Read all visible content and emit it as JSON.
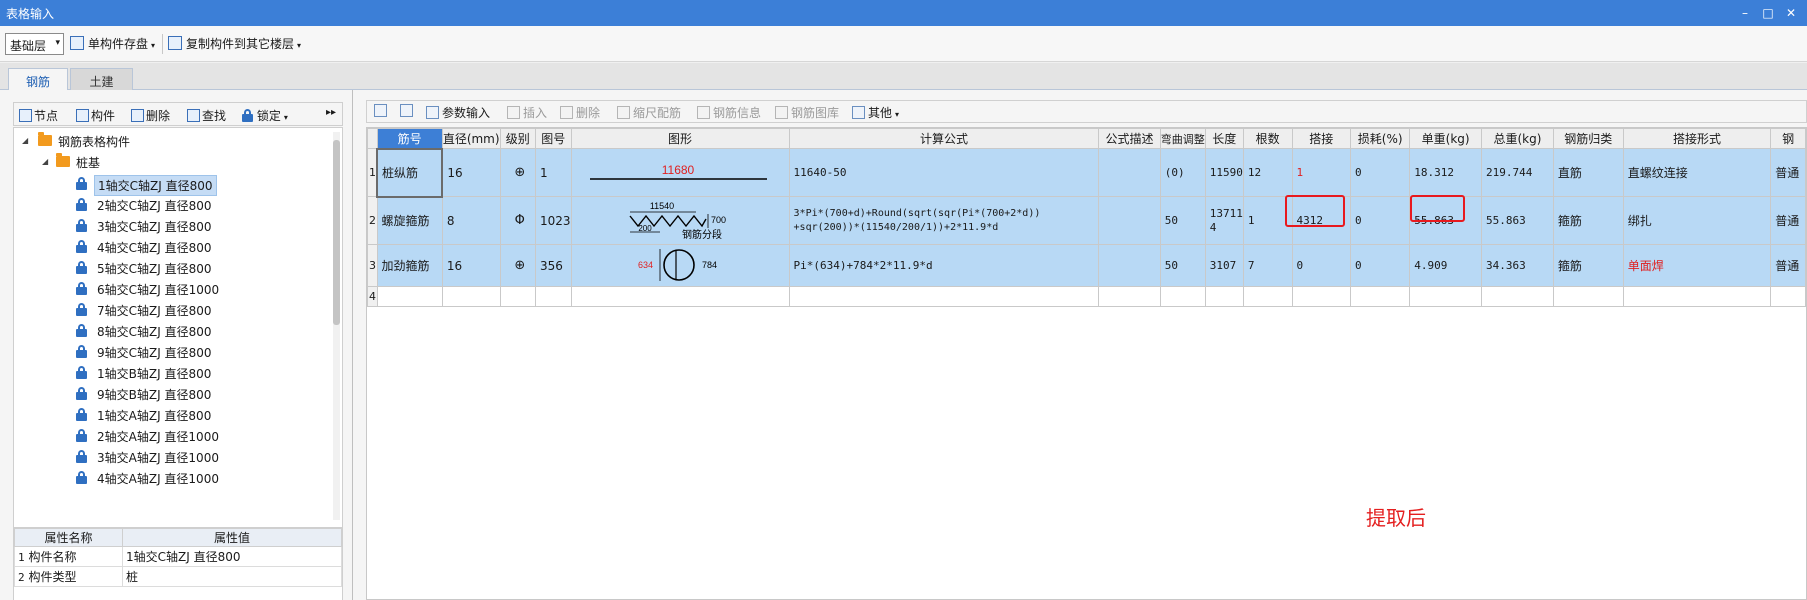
{
  "window": {
    "title": "表格输入",
    "controls": [
      "–",
      "□",
      "✕"
    ]
  },
  "toolbar": {
    "floor": "基础层",
    "save_single": "单构件存盘",
    "copy_to_floor": "复制构件到其它楼层"
  },
  "tabs": [
    "钢筋",
    "土建"
  ],
  "left_toolbar": {
    "node": "节点",
    "component": "构件",
    "delete": "删除",
    "find": "查找",
    "lock": "锁定",
    "more": "▸▸"
  },
  "tree": {
    "root": "钢筋表格构件",
    "group": "桩基",
    "items": [
      "1轴交C轴ZJ 直径800",
      "2轴交C轴ZJ 直径800",
      "3轴交C轴ZJ 直径800",
      "4轴交C轴ZJ 直径800",
      "5轴交C轴ZJ 直径800",
      "6轴交C轴ZJ 直径1000",
      "7轴交C轴ZJ 直径800",
      "8轴交C轴ZJ 直径800",
      "9轴交C轴ZJ 直径800",
      "1轴交B轴ZJ 直径800",
      "9轴交B轴ZJ 直径800",
      "1轴交A轴ZJ 直径800",
      "2轴交A轴ZJ 直径1000",
      "3轴交A轴ZJ 直径1000",
      "4轴交A轴ZJ 直径1000"
    ]
  },
  "properties": {
    "headers": [
      "属性名称",
      "属性值"
    ],
    "rows": [
      {
        "idx": "1",
        "name": "构件名称",
        "value": "1轴交C轴ZJ 直径800"
      },
      {
        "idx": "2",
        "name": "构件类型",
        "value": "桩"
      }
    ]
  },
  "right_toolbar": {
    "param_input": "参数输入",
    "insert": "插入",
    "delete": "删除",
    "scale_rebar": "缩尺配筋",
    "rebar_info": "钢筋信息",
    "rebar_library": "钢筋图库",
    "other": "其他"
  },
  "grid": {
    "headers": [
      "筋号",
      "直径(mm)",
      "级别",
      "图号",
      "图形",
      "计算公式",
      "公式描述",
      "弯曲调整",
      "长度",
      "根数",
      "搭接",
      "损耗(%)",
      "单重(kg)",
      "总重(kg)",
      "钢筋归类",
      "搭接形式",
      "钢"
    ],
    "rows": [
      {
        "idx": "1",
        "name": "桩纵筋",
        "diameter": "16",
        "grade": "⊕",
        "figure_no": "1",
        "shape_len": "11680",
        "formula": "11640-50",
        "formula_desc": "",
        "bend_adjust": "(0)",
        "length": "11590",
        "count": "12",
        "lap": "1",
        "loss": "0",
        "unit_weight": "18.312",
        "total_weight": "219.744",
        "category": "直筋",
        "lap_type": "直螺纹连接",
        "extra": "普通"
      },
      {
        "idx": "2",
        "name": "螺旋箍筋",
        "diameter": "8",
        "grade": "Φ",
        "figure_no": "1023",
        "shape_len": "11540",
        "shape_pitch": "200",
        "shape_height": "700",
        "shape_note": "钢筋分段",
        "formula_line1": "3*Pi*(700+d)+Round(sqrt(sqr(Pi*(700+2*d))",
        "formula_line2": "+sqr(200))*(11540/200/1))+2*11.9*d",
        "formula_desc": "",
        "bend_adjust": "50",
        "length_line1": "13711",
        "length_line2": "4",
        "count": "1",
        "lap": "4312",
        "loss": "0",
        "unit_weight": "55.863",
        "total_weight": "55.863",
        "category": "箍筋",
        "lap_type": "绑扎",
        "extra": "普通"
      },
      {
        "idx": "3",
        "name": "加劲箍筋",
        "diameter": "16",
        "grade": "⊕",
        "figure_no": "356",
        "shape_left": "634",
        "shape_right": "784",
        "formula": "Pi*(634)+784*2*11.9*d",
        "formula_desc": "",
        "bend_adjust": "50",
        "length": "3107",
        "count": "7",
        "lap": "0",
        "loss": "0",
        "unit_weight": "4.909",
        "total_weight": "34.363",
        "category": "箍筋",
        "lap_type": "单面焊",
        "extra": "普通"
      }
    ],
    "empty_row_idx": "4"
  },
  "annotation": "提取后",
  "colors": {
    "titlebar": "#3c7fd7",
    "row_highlight": "#b8d9f5",
    "header_first": "#3d7fd6",
    "annotation_red": "#e41f1f"
  }
}
